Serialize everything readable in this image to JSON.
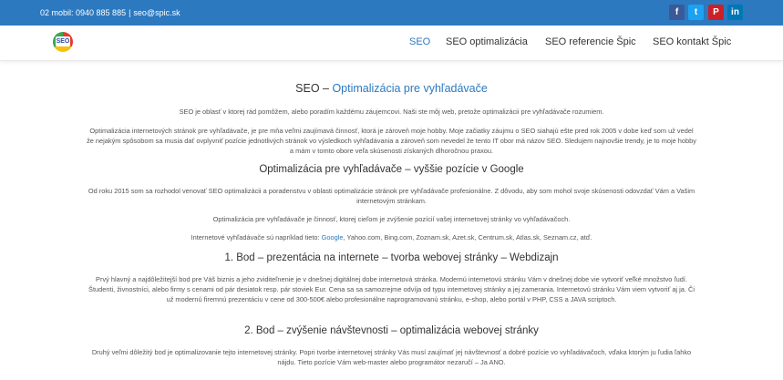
{
  "topbar": {
    "phone": "02 mobil: 0940 885 885",
    "separator": "|",
    "email": "seo@spic.sk",
    "social": [
      {
        "name": "facebook-icon",
        "glyph": "f",
        "color": "#3b5998"
      },
      {
        "name": "twitter-icon",
        "glyph": "t",
        "color": "#1da1f2"
      },
      {
        "name": "pinterest-icon",
        "glyph": "P",
        "color": "#cb2027"
      },
      {
        "name": "linkedin-icon",
        "glyph": "in",
        "color": "#0077b5"
      }
    ]
  },
  "header": {
    "logo_text": "SEO",
    "nav": [
      "SEO",
      "SEO optimalizácia",
      "SEO referencie Špic",
      "SEO kontakt Špic"
    ]
  },
  "main": {
    "title_part1": "SEO – ",
    "title_part2": "Optimalizácia pre vyhľadávače",
    "intro": "SEO je oblasť v ktorej rád pomôžem, alebo poradím každému záujemcovi. Naši ste môj web, pretože optimalizácii pre vyhľadávače rozumiem.",
    "para1": "Optimalizácia internetových stránok pre vyhľadávače, je pre mňa veľmi zaujímavá činnosť, ktorá je zároveň moje hobby. Moje začiatky záujmu o SEO siahajú ešte pred rok 2005 v dobe keď som už vedel že nejakým spôsobom sa musia dať ovplyvniť pozície jednotlivých stránok vo výsledkoch vyhľadávania a zároveň som nevedel že tento IT obor má názov SEO. Sledujem najnovšie trendy, je to moje hobby a mám v tomto obore veľa skúsenosti získaných dlhoročnou praxou.",
    "heading2": "Optimalizácia pre vyhľadávače – vyššie pozície v Google",
    "para2": "Od roku 2015 som sa rozhodol venovať SEO optimalizácii a poradenstvu v oblasti optimalizácie stránok pre vyhľadávače profesionálne. Z dôvodu, aby som mohol svoje skúsenosti odovzdať Vám a Vašim internetovým stránkam.",
    "para3": "Optimalizácia pre vyhľadávače je činnosť, ktorej cieľom je zvýšenie pozícií vašej internetovej stránky vo vyhľadávačoch.",
    "para4_before": "Internetové vyhľadávače sú napríklad tieto: ",
    "para4_link": "Google",
    "para4_after": ", Yahoo.com, Bing.com, Zoznam.sk, Azet.sk, Centrum.sk, Atlas.sk, Seznam.cz, atď.",
    "heading3": "1. Bod – prezentácia na internete – tvorba webovej stránky – Webdizajn",
    "para5": "Prvý hlavný a najdôležitejší bod pre Váš biznis a jeho zviditeľnenie je v dnešnej digitálnej dobe internetová stránka. Modernú internetovú stránku Vám v dnešnej dobe vie vytvoriť veľké množstvo ľudí. Študenti, živnostníci, alebo firmy s cenami od pár desiatok resp. pár stoviek Eur. Cena sa sa samozrejme odvíja od typu internetovej stránky a jej zamerania. Internetovú stránku Vám viem vytvoriť aj ja. Či už modernú firemnú prezentáciu v cene od 300-500€ alebo profesionálne naprogramovanú stránku, e-shop, alebo portál v PHP, CSS a JAVA scriptoch.",
    "heading4": "2. Bod – zvýšenie návštevnosti – optimalizácia webovej stránky",
    "para6": "Druhý veľmi dôležitý bod je optimalizovanie tejto internetovej stránky. Popri tvorbe internetovej stránky Vás musí zaujímať jej návštevnosť a dobré pozície vo vyhľadávačoch, vďaka ktorým ju ľudia ľahko nájdu. Tieto pozície Vám web-master alebo programátor nezaručí – Ja ANO."
  }
}
